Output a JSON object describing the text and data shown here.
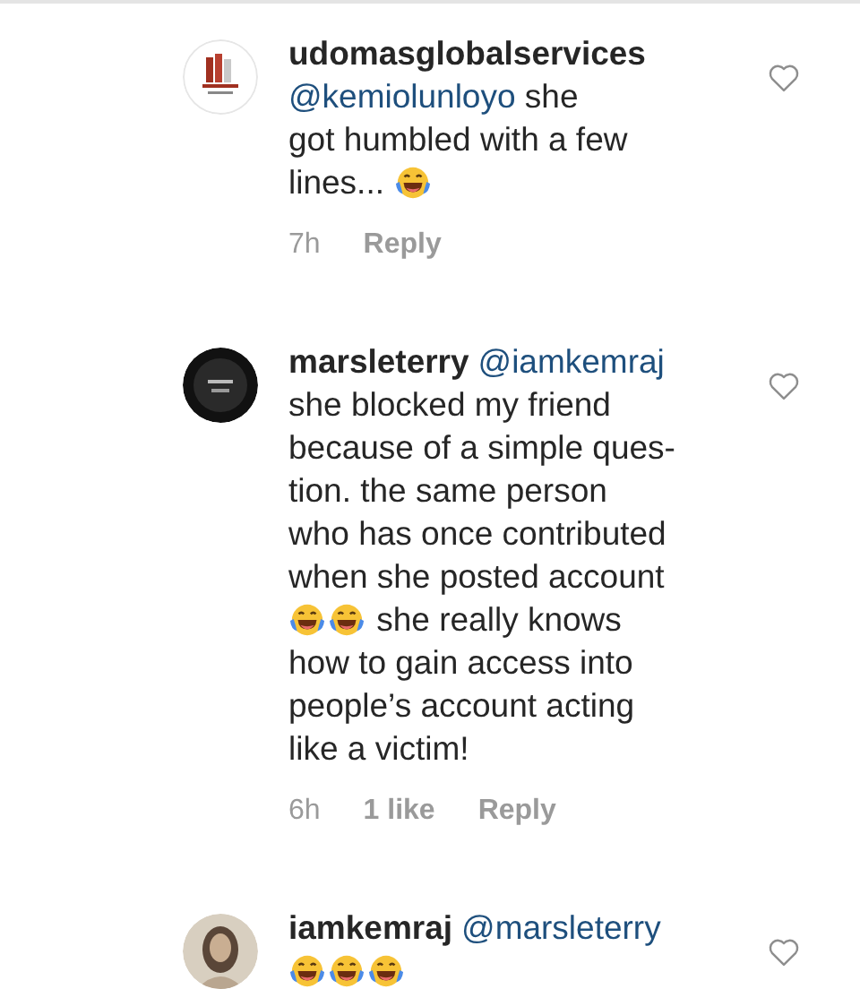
{
  "comments": [
    {
      "avatar": {
        "kind": "logo"
      },
      "liked": false,
      "lines": [
        [
          {
            "kind": "username",
            "text": "udomasglobalservices"
          }
        ],
        [
          {
            "kind": "mention",
            "text": "@kemiolunloyo"
          },
          {
            "kind": "text",
            "text": " she"
          }
        ],
        [
          {
            "kind": "text",
            "text": "got humbled with a few"
          }
        ],
        [
          {
            "kind": "text",
            "text": "lines... "
          },
          {
            "kind": "emoji"
          }
        ]
      ],
      "time": "7h",
      "reply": "Reply"
    },
    {
      "avatar": {
        "kind": "dark"
      },
      "liked": false,
      "lines": [
        [
          {
            "kind": "username",
            "text": "marsleterry"
          },
          {
            "kind": "mention",
            "text": "@iamkemraj"
          }
        ],
        [
          {
            "kind": "text",
            "text": "she blocked my friend"
          }
        ],
        [
          {
            "kind": "text",
            "text": "because of a simple ques-"
          }
        ],
        [
          {
            "kind": "text",
            "text": "tion. the same person"
          }
        ],
        [
          {
            "kind": "text",
            "text": "who has once contributed"
          }
        ],
        [
          {
            "kind": "text",
            "text": "when she posted account"
          }
        ],
        [
          {
            "kind": "emoji"
          },
          {
            "kind": "emoji"
          },
          {
            "kind": "text",
            "text": " she really knows"
          }
        ],
        [
          {
            "kind": "text",
            "text": "how to gain access into"
          }
        ],
        [
          {
            "kind": "text",
            "text": "people’s account acting"
          }
        ],
        [
          {
            "kind": "text",
            "text": "like a victim!"
          }
        ]
      ],
      "time": "6h",
      "likes": "1 like",
      "reply": "Reply"
    },
    {
      "avatar": {
        "kind": "photo"
      },
      "liked": false,
      "lines": [
        [
          {
            "kind": "username",
            "text": "iamkemraj"
          },
          {
            "kind": "mention",
            "text": "@marsleterry"
          }
        ],
        [
          {
            "kind": "emoji"
          },
          {
            "kind": "emoji"
          },
          {
            "kind": "emoji"
          }
        ]
      ]
    }
  ]
}
